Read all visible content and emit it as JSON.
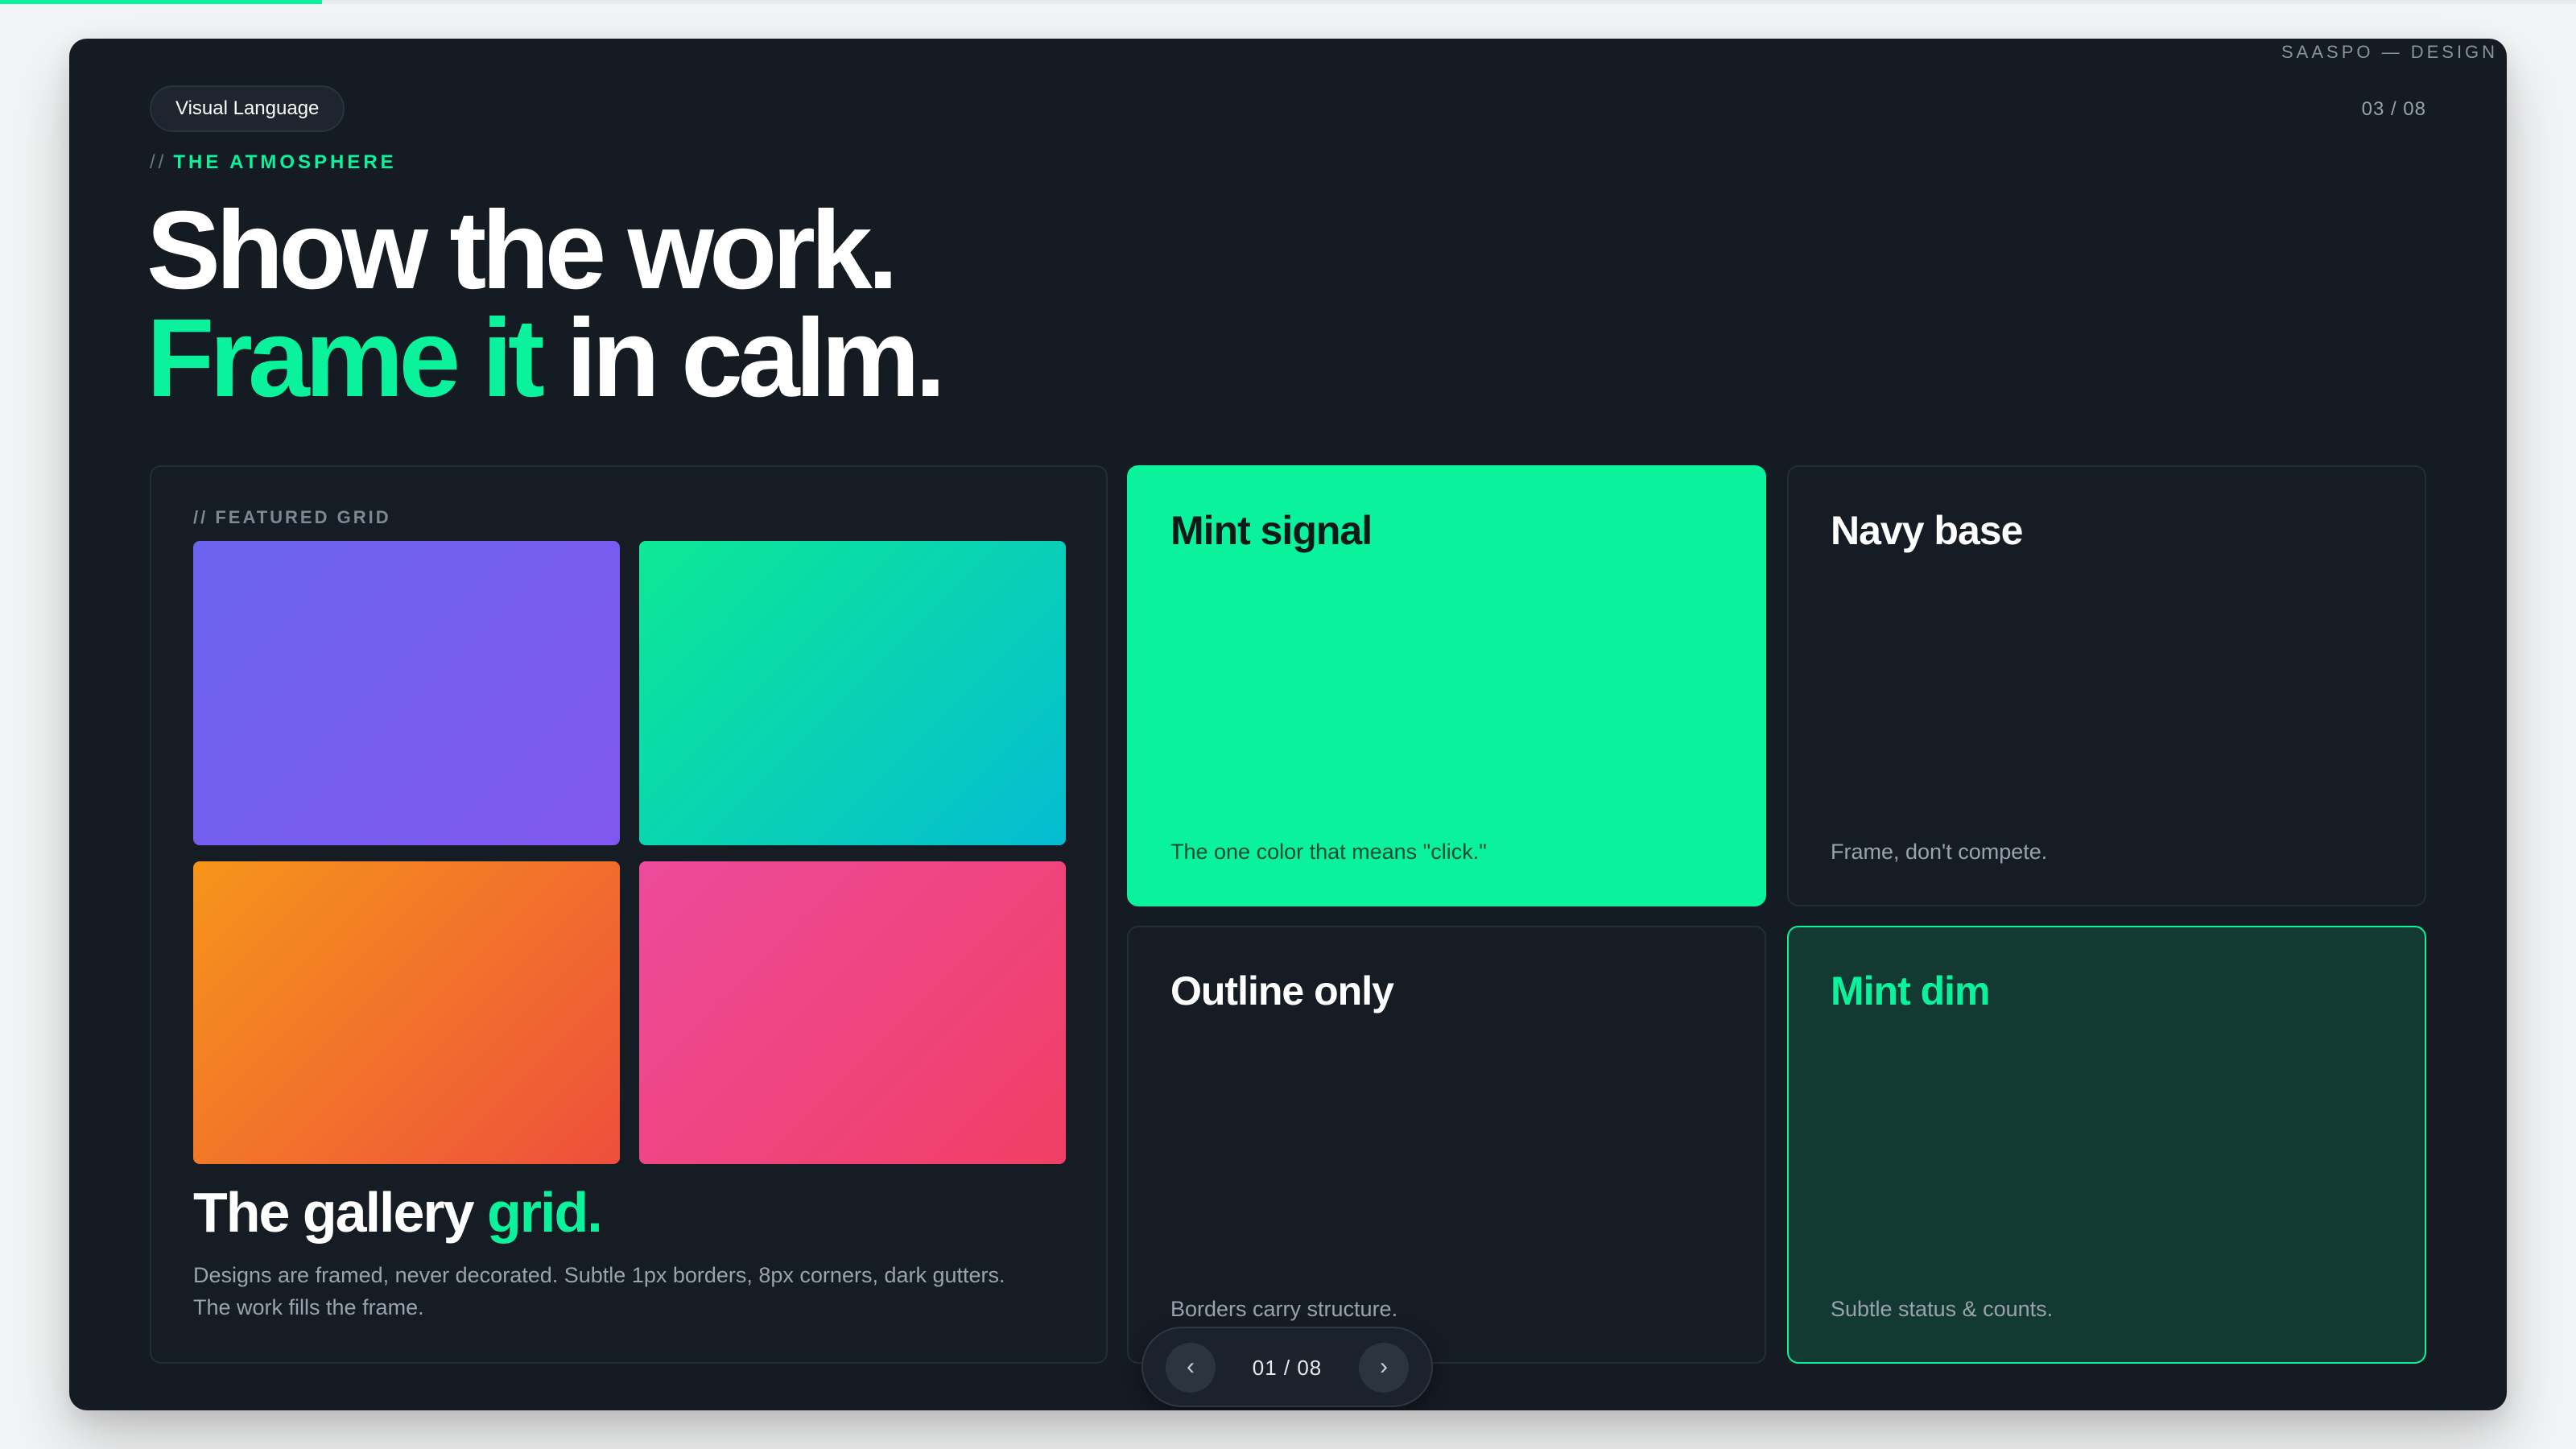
{
  "progress": {
    "fraction": 0.125,
    "color": "#0af29b"
  },
  "deck_title": "SAASPO — DESIGN DE",
  "header": {
    "pill_label": "Visual Language",
    "page_counter": "03 / 08",
    "eyebrow_prefix": "//",
    "eyebrow": "THE ATMOSPHERE",
    "headline_line1": "Show the work.",
    "headline_line2_accent": "Frame it",
    "headline_line2_rest": " in calm."
  },
  "featured": {
    "label": "// FEATURED GRID",
    "title_main": "The gallery ",
    "title_accent": "grid.",
    "description_line1": "Designs are framed, never decorated. Subtle 1px borders, 8px corners, dark gutters.",
    "description_line2": "The work fills the frame."
  },
  "cards": [
    {
      "title": "Mint signal",
      "subtitle": "The one color that means \"click.\""
    },
    {
      "title": "Navy base",
      "subtitle": "Frame, don't compete."
    },
    {
      "title": "Outline only",
      "subtitle": "Borders carry structure."
    },
    {
      "title": "Mint dim",
      "subtitle": "Subtle status & counts."
    }
  ],
  "pager": {
    "prev_label": "‹",
    "next_label": "›",
    "count": "01 / 08"
  },
  "colors": {
    "mint": "#0af29b",
    "navy": "#151b23",
    "mint_dim": "#123a33"
  }
}
